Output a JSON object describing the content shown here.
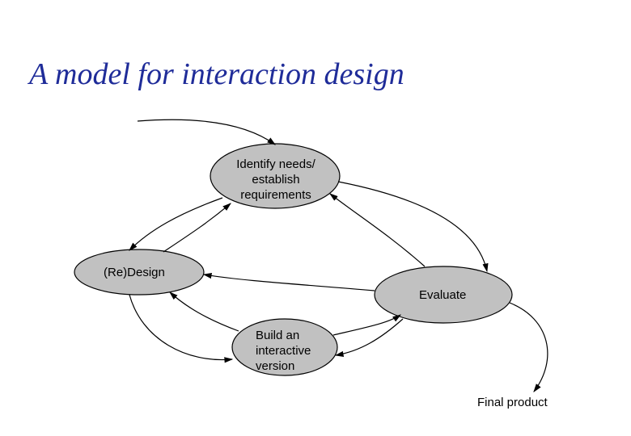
{
  "title": "A model for interaction design",
  "nodes": {
    "identify": {
      "line1": "Identify needs/",
      "line2": "establish",
      "line3": "requirements"
    },
    "redesign": {
      "label": "(Re)Design"
    },
    "build": {
      "line1": "Build an",
      "line2": "interactive",
      "line3": "version"
    },
    "evaluate": {
      "label": "Evaluate"
    }
  },
  "final_label": "Final product"
}
